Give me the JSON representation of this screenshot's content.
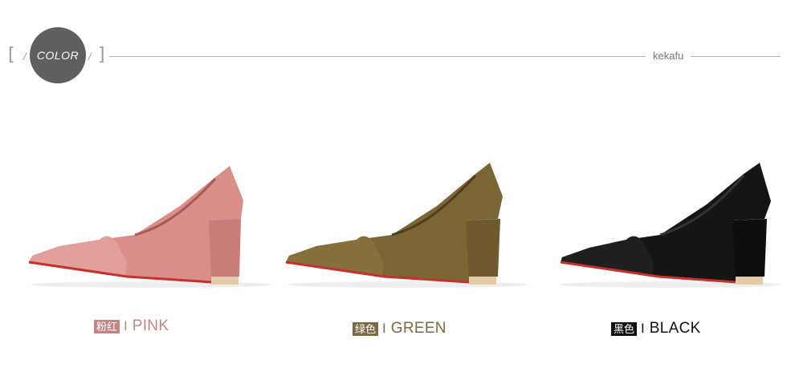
{
  "header": {
    "badge": "COLOR",
    "bracket_left": "[",
    "bracket_right": "]",
    "slash": "/",
    "brand": "kekafu"
  },
  "colors": {
    "pink": "#d98e8c",
    "green": "#7a6535",
    "black": "#151515",
    "pink_tag": "#c58585",
    "green_tag": "#7a6a45",
    "black_tag": "#111111"
  },
  "products": [
    {
      "cn": "粉红",
      "en": "PINK"
    },
    {
      "cn": "绿色",
      "en": "GREEN"
    },
    {
      "cn": "黑色",
      "en": "BLACK"
    }
  ],
  "separator": "I"
}
